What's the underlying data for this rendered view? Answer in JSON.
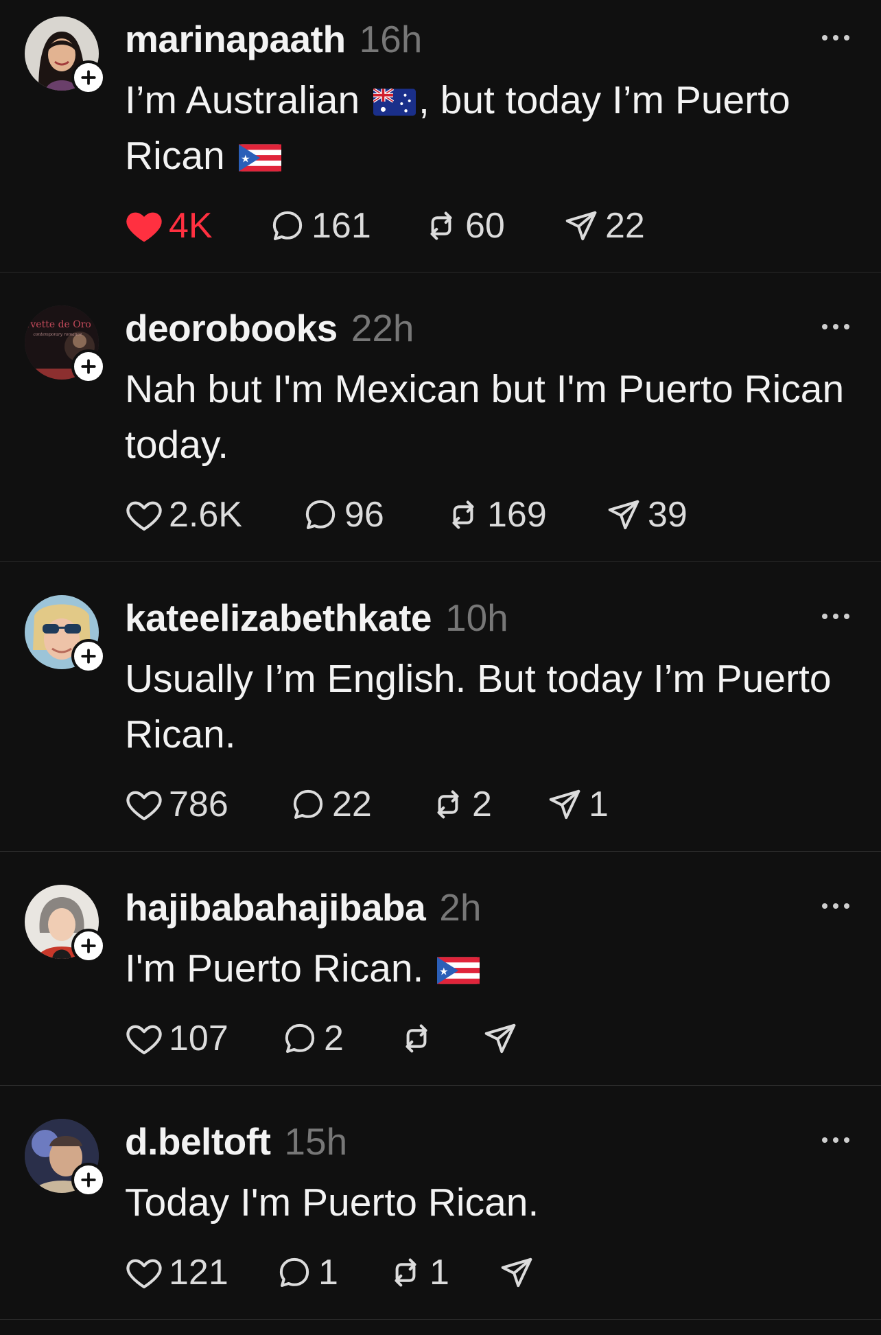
{
  "posts": [
    {
      "username": "marinapaath",
      "time": "16h",
      "text_parts": [
        "I’m Australian ",
        ", but today I’m Puerto Rican "
      ],
      "flags": [
        "australia-flag",
        "puerto-rico-flag"
      ],
      "liked": true,
      "likes": "4K",
      "replies": "161",
      "reposts": "60",
      "shares": "22"
    },
    {
      "username": "deorobooks",
      "time": "22h",
      "text": "Nah but I'm Mexican but I'm Puerto Rican today.",
      "avatar_text": "Yvette de Oro",
      "avatar_subtext": "contemporary romance",
      "liked": false,
      "likes": "2.6K",
      "replies": "96",
      "reposts": "169",
      "shares": "39"
    },
    {
      "username": "kateelizabethkate",
      "time": "10h",
      "text": "Usually I’m English. But today I’m Puerto Rican.",
      "liked": false,
      "likes": "786",
      "replies": "22",
      "reposts": "2",
      "shares": "1"
    },
    {
      "username": "hajibabahajibaba",
      "time": "2h",
      "text": "I'm Puerto Rican. ",
      "flags": [
        "puerto-rico-flag"
      ],
      "liked": false,
      "likes": "107",
      "replies": "2",
      "reposts": "",
      "shares": ""
    },
    {
      "username": "d.beltoft",
      "time": "15h",
      "text": "Today I'm Puerto Rican.",
      "liked": false,
      "likes": "121",
      "replies": "1",
      "reposts": "1",
      "shares": ""
    }
  ],
  "colors": {
    "background": "#101010",
    "text": "#f3f3f3",
    "muted": "#777777",
    "like_active": "#ff3040",
    "divider": "#2a2a2a"
  }
}
